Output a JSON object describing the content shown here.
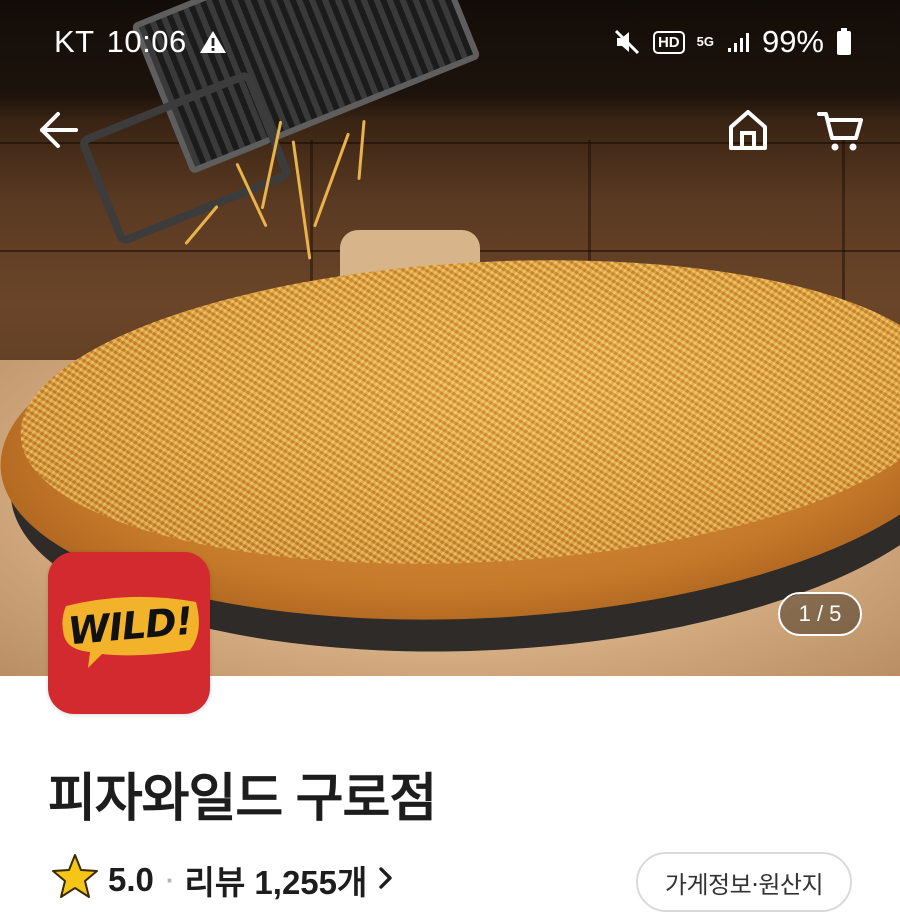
{
  "status_bar": {
    "carrier": "KT",
    "time": "10:06",
    "hd_label": "HD",
    "network": "5G",
    "battery": "99%"
  },
  "hero": {
    "page_counter": "1 / 5"
  },
  "store": {
    "logo_text": "WILD!",
    "name": "피자와일드 구로점",
    "rating": "5.0",
    "separator": "·",
    "reviews": "리뷰 1,255개",
    "info_button": "가게정보·원산지"
  },
  "icons": {
    "back": "arrow-left-icon",
    "home": "home-icon",
    "cart": "cart-icon",
    "star": "star-icon",
    "chevron": "chevron-right-icon"
  },
  "colors": {
    "logo_red": "#d32a2f",
    "logo_yellow": "#f2b32a",
    "star_yellow": "#f5c518"
  }
}
